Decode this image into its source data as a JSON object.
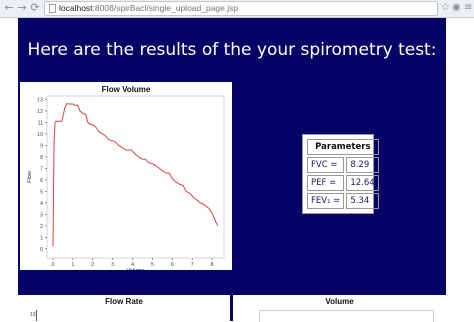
{
  "browser": {
    "back_icon": "←",
    "forward_icon": "→",
    "reload_icon": "⟳",
    "url_host": "localhost",
    "url_rest": ":8008/spirBacl/single_upload_page.jsp",
    "star_icon": "☆",
    "eye_icon": "◉",
    "menu_icon": "≡"
  },
  "page": {
    "heading": "Here are the results of the your spirometry test:"
  },
  "parameters": {
    "title": "Parameters",
    "rows": [
      {
        "label": "FVC =",
        "value": "8.29"
      },
      {
        "label": "PEF =",
        "value": "12.64"
      },
      {
        "label": "FEV₁ =",
        "value": "5.34"
      }
    ]
  },
  "bottom_panels": {
    "left_title": "Flow Rate",
    "right_title": "Volume",
    "left_tick": "13"
  },
  "chart_data": {
    "type": "line",
    "title": "Flow Volume",
    "xlabel": "Volume",
    "ylabel": "Flow",
    "xlim": [
      -0.3,
      8.6
    ],
    "ylim": [
      -0.8,
      13.3
    ],
    "xticks": [
      0,
      1,
      2,
      3,
      4,
      5,
      6,
      7,
      8
    ],
    "yticks": [
      0,
      1,
      2,
      3,
      4,
      5,
      6,
      7,
      8,
      9,
      10,
      11,
      12,
      13
    ],
    "line_color": "#d9453f",
    "series": [
      {
        "x": [
          0,
          0.02,
          0.05,
          0.1,
          0.15,
          0.2,
          0.3,
          0.45,
          0.6,
          0.7,
          0.8,
          1.0,
          1.1,
          1.25,
          1.35,
          1.5,
          1.65,
          1.75,
          1.9,
          2.0,
          2.15,
          2.3,
          2.5,
          2.65,
          2.8,
          3.0,
          3.15,
          3.3,
          3.5,
          3.65,
          3.8,
          3.95,
          4.1,
          4.3,
          4.5,
          4.65,
          4.8,
          5.0,
          5.2,
          5.35,
          5.5,
          5.7,
          5.85,
          6.0,
          6.2,
          6.4,
          6.55,
          6.7,
          6.9,
          7.05,
          7.2,
          7.4,
          7.55,
          7.7,
          7.85,
          8.0,
          8.1,
          8.2,
          8.29
        ],
        "y": [
          0.2,
          4,
          9,
          11,
          11.1,
          11.1,
          11.1,
          11.1,
          12.3,
          12.64,
          12.6,
          12.6,
          12.5,
          12.5,
          12.0,
          11.8,
          11.7,
          11.0,
          10.8,
          10.8,
          10.6,
          10.2,
          10.0,
          9.8,
          9.5,
          9.4,
          9.3,
          9.0,
          8.8,
          8.6,
          8.6,
          8.6,
          8.3,
          8.0,
          7.8,
          7.8,
          7.5,
          7.4,
          7.2,
          7.0,
          6.8,
          6.6,
          6.6,
          6.1,
          5.8,
          5.6,
          5.5,
          5.0,
          4.8,
          4.5,
          4.3,
          4.0,
          3.9,
          3.7,
          3.5,
          3.1,
          2.7,
          2.3,
          2.0
        ]
      }
    ]
  }
}
